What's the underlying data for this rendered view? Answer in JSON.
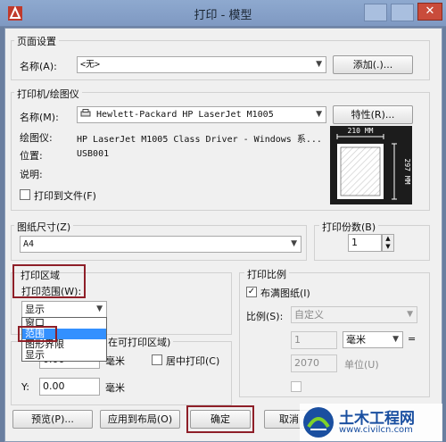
{
  "window": {
    "title": "打印 - 模型",
    "close_glyph": "✕"
  },
  "page_setup": {
    "group_title": "页面设置",
    "name_label": "名称(A):",
    "name_value": "<无>",
    "add_button": "添加(.)..."
  },
  "printer": {
    "group_title": "打印机/绘图仪",
    "name_label": "名称(M):",
    "name_value": "Hewlett-Packard HP LaserJet M1005",
    "properties_button": "特性(R)...",
    "plotter_label": "绘图仪:",
    "plotter_value": "HP LaserJet M1005 Class Driver - Windows 系...",
    "location_label": "位置:",
    "location_value": "USB001",
    "description_label": "说明:",
    "print_to_file_label": "打印到文件(F)",
    "preview_width": "210 MM",
    "preview_height": "297 MM"
  },
  "paper_size": {
    "group_title": "图纸尺寸(Z)",
    "value": "A4"
  },
  "copies": {
    "label": "打印份数(B)",
    "value": "1"
  },
  "plot_area": {
    "group_title": "打印区域",
    "range_label": "打印范围(W):",
    "range_value": "显示",
    "options": [
      "窗口",
      "范围",
      "图形界限",
      "显示"
    ],
    "selected_option": "范围"
  },
  "plot_offset": {
    "title_partial": "在可打印区域)",
    "x_value": "0.00",
    "x_unit": "毫米",
    "center_label": "居中打印(C)",
    "y_label": "Y:",
    "y_value": "0.00",
    "y_unit": "毫米"
  },
  "plot_scale": {
    "group_title": "打印比例",
    "fit_label": "布满图纸(I)",
    "fit_checked": true,
    "scale_label": "比例(S):",
    "scale_value": "自定义",
    "value1": "1",
    "unit": "毫米",
    "equals": "=",
    "value2": "2070",
    "unit2": "单位(U)"
  },
  "footer": {
    "preview": "预览(P)...",
    "apply": "应用到布局(O)",
    "ok": "确定",
    "cancel": "取消"
  },
  "watermark": {
    "name": "土木工程网",
    "url": "www.civilcn.com"
  },
  "colors": {
    "titlebar": "#8ea9cf",
    "highlight": "#3390ff",
    "red_box": "#8e1f28",
    "watermark_blue": "#1a4fa0"
  }
}
